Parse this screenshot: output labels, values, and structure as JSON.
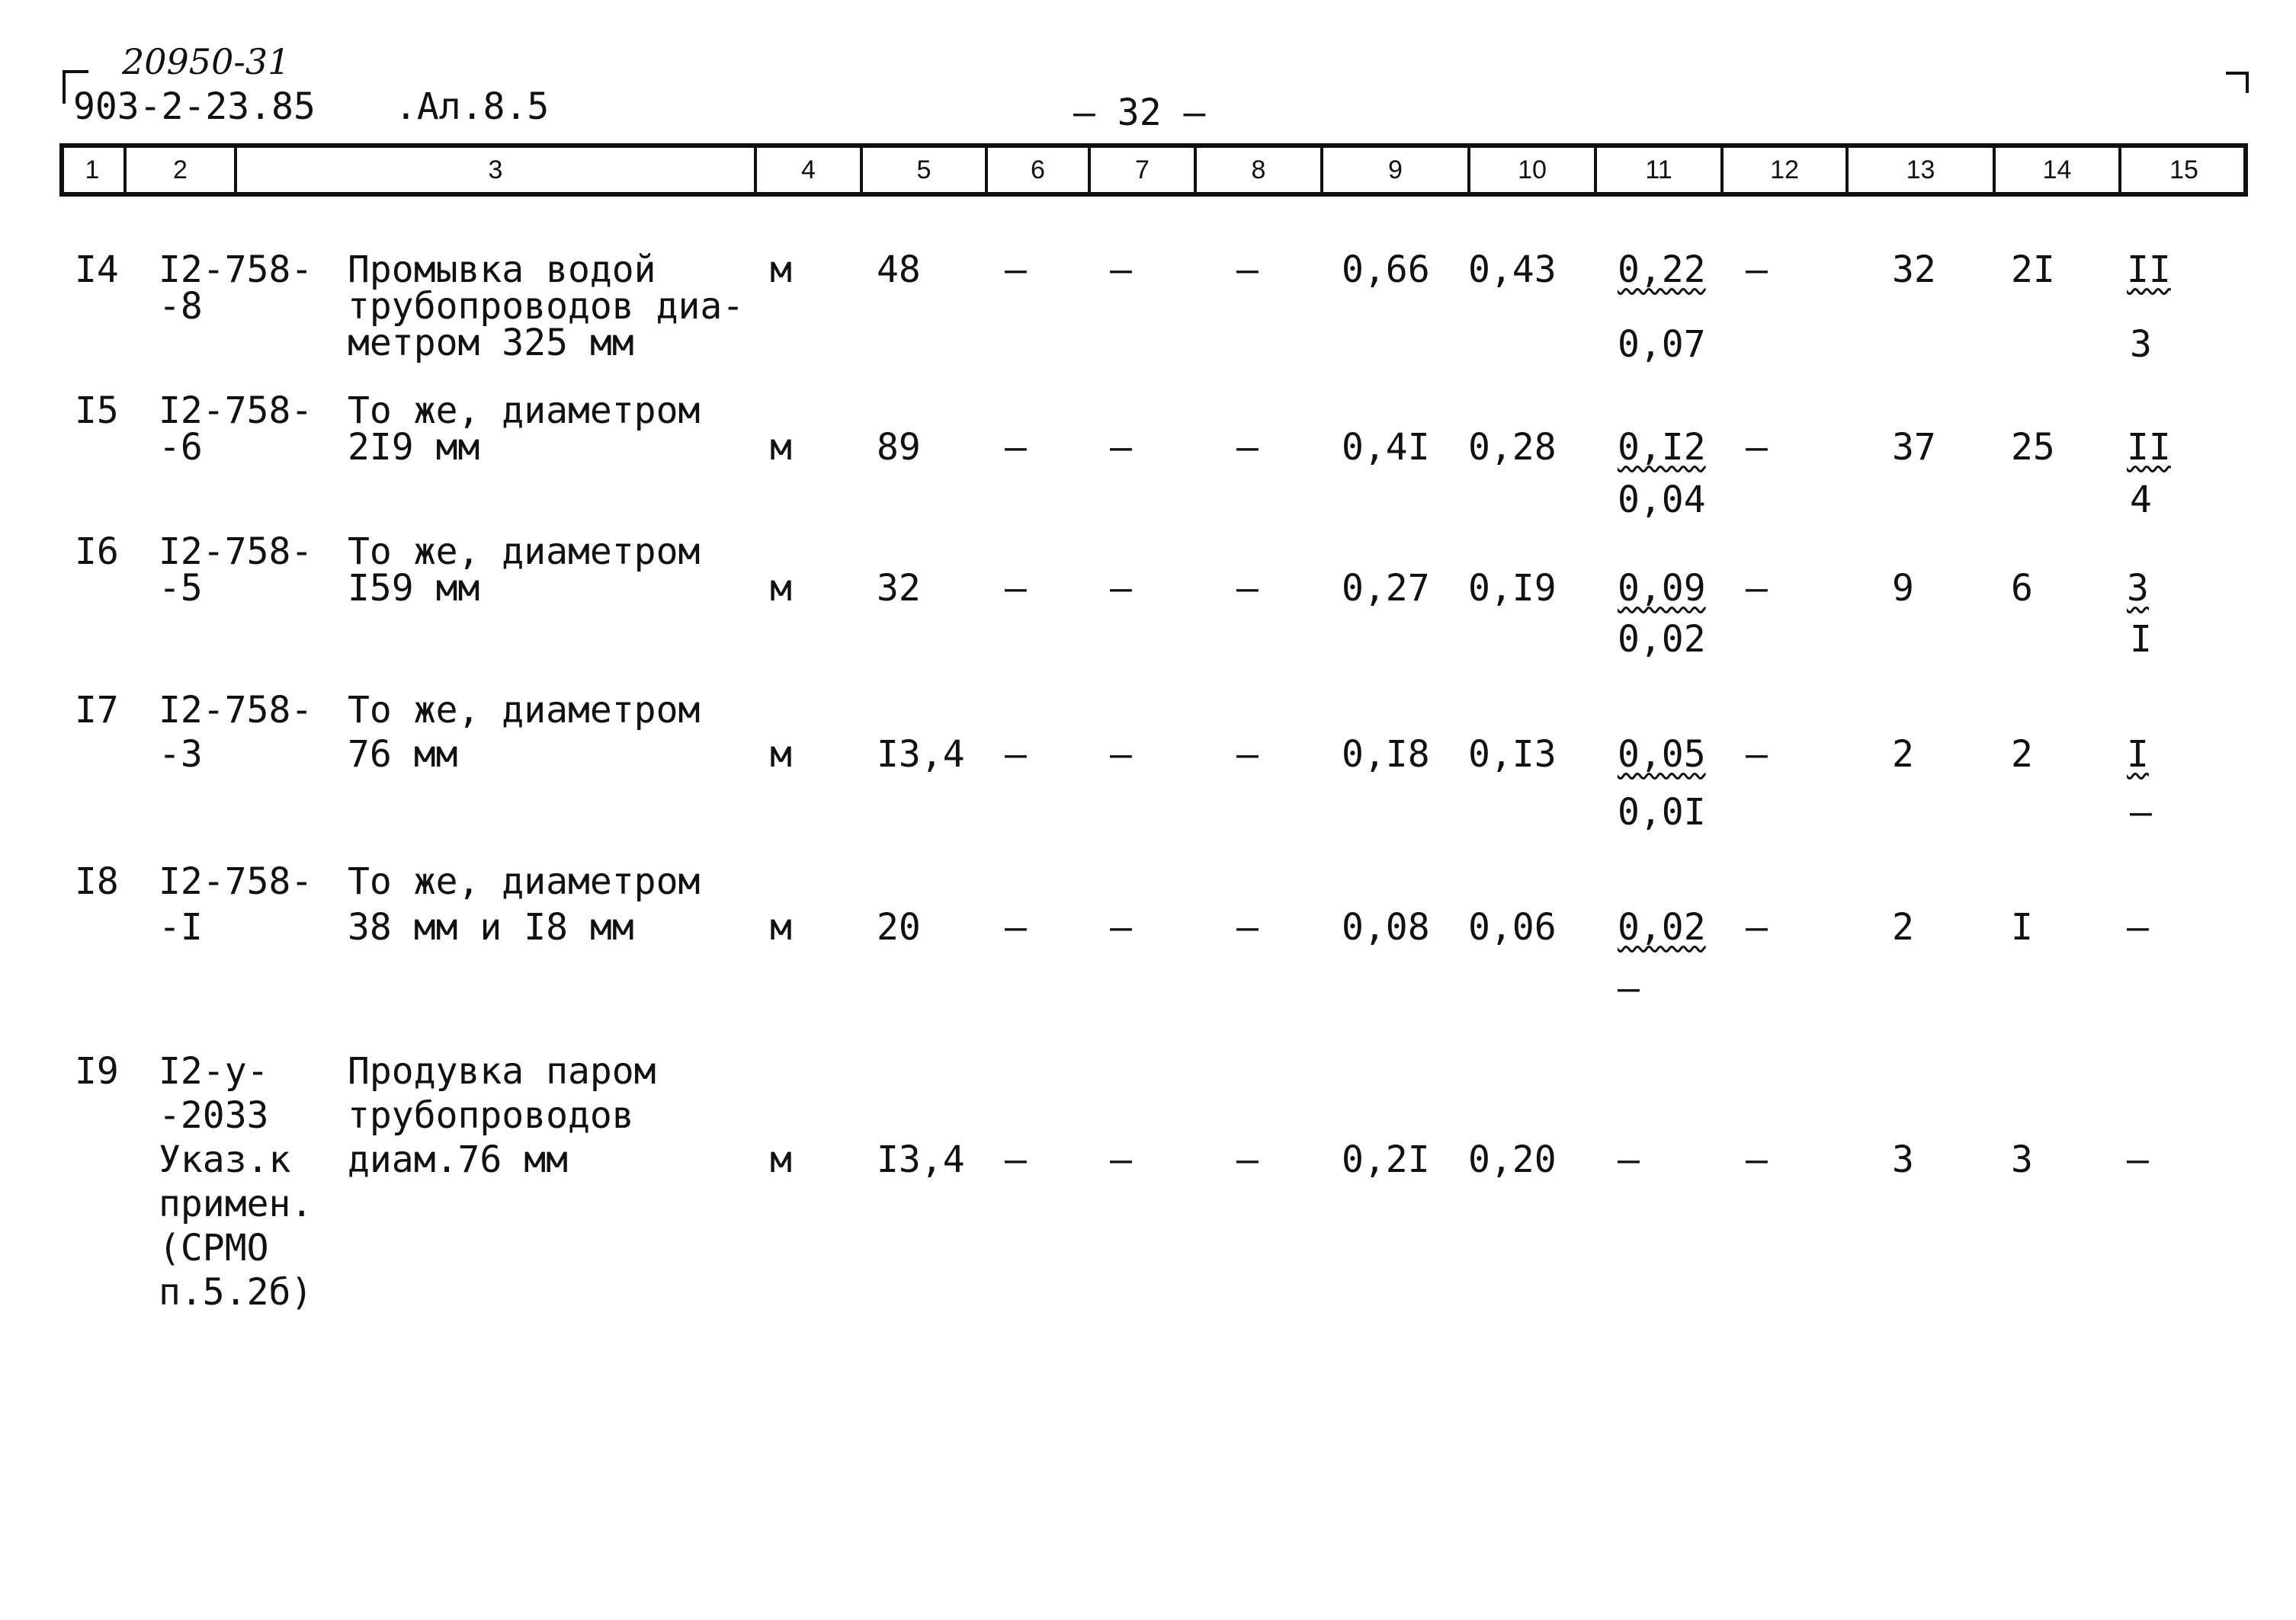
{
  "header": {
    "handwritten_number": "20950-31",
    "document_code": "903-2-23.85",
    "sheet_ref": ".Ал.8.5",
    "page_number": "— 32 —"
  },
  "columns": [
    "1",
    "2",
    "3",
    "4",
    "5",
    "6",
    "7",
    "8",
    "9",
    "10",
    "11",
    "12",
    "13",
    "14",
    "15"
  ],
  "rows": [
    {
      "num": "I4",
      "code": [
        "I2-758-",
        "-8"
      ],
      "desc": [
        "Промывка водой",
        "трубопроводов диа-",
        "метром 325 мм"
      ],
      "unit": "м",
      "qty": "48",
      "c6": "–",
      "c7": "–",
      "c8": "–",
      "c9": "0,66",
      "c10": "0,43",
      "c11_top": "0,22",
      "c11_bottom": "0,07",
      "c12": "–",
      "c13": "32",
      "c14": "2I",
      "c15_top": "II",
      "c15_bottom": "3"
    },
    {
      "num": "I5",
      "code": [
        "I2-758-",
        "-6"
      ],
      "desc": [
        "То же, диаметром",
        "2I9 мм"
      ],
      "unit": "м",
      "qty": "89",
      "c6": "–",
      "c7": "–",
      "c8": "–",
      "c9": "0,4I",
      "c10": "0,28",
      "c11_top": "0,I2",
      "c11_bottom": "0,04",
      "c12": "–",
      "c13": "37",
      "c14": "25",
      "c15_top": "II",
      "c15_bottom": "4"
    },
    {
      "num": "I6",
      "code": [
        "I2-758-",
        "-5"
      ],
      "desc": [
        "То же, диаметром",
        "I59 мм"
      ],
      "unit": "м",
      "qty": "32",
      "c6": "–",
      "c7": "–",
      "c8": "–",
      "c9": "0,27",
      "c10": "0,I9",
      "c11_top": "0,09",
      "c11_bottom": "0,02",
      "c12": "–",
      "c13": "9",
      "c14": "6",
      "c15_top": "3",
      "c15_bottom": "I"
    },
    {
      "num": "I7",
      "code": [
        "I2-758-",
        "-3"
      ],
      "desc": [
        "То же, диаметром",
        "76 мм"
      ],
      "unit": "м",
      "qty": "I3,4",
      "c6": "–",
      "c7": "–",
      "c8": "–",
      "c9": "0,I8",
      "c10": "0,I3",
      "c11_top": "0,05",
      "c11_bottom": "0,0I",
      "c12": "–",
      "c13": "2",
      "c14": "2",
      "c15_top": "I",
      "c15_bottom": "–"
    },
    {
      "num": "I8",
      "code": [
        "I2-758-",
        "-I"
      ],
      "desc": [
        "То же, диаметром",
        "38 мм и I8 мм"
      ],
      "unit": "м",
      "qty": "20",
      "c6": "–",
      "c7": "–",
      "c8": "–",
      "c9": "0,08",
      "c10": "0,06",
      "c11_top": "0,02",
      "c11_bottom": "–",
      "c12": "–",
      "c13": "2",
      "c14": "I",
      "c15_top": "–",
      "c15_bottom": ""
    },
    {
      "num": "I9",
      "code": [
        "I2-у-",
        "-2033",
        "Указ.к",
        "примен.",
        "(СРМО",
        "п.5.2б)"
      ],
      "desc": [
        "Продувка паром",
        "трубопроводов",
        "диам.76 мм"
      ],
      "unit": "м",
      "qty": "I3,4",
      "c6": "–",
      "c7": "–",
      "c8": "–",
      "c9": "0,2I",
      "c10": "0,20",
      "c11_top": "–",
      "c11_bottom": "",
      "c12": "–",
      "c13": "3",
      "c14": "3",
      "c15_top": "–",
      "c15_bottom": ""
    }
  ]
}
